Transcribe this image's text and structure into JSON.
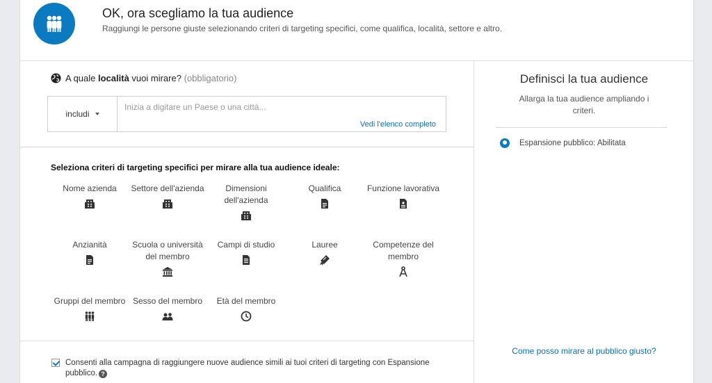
{
  "header": {
    "title": "OK, ora scegliamo la tua audience",
    "subtitle": "Raggiungi le persone giuste selezionando criteri di targeting specifici, come qualifica, località, settore e altro.",
    "icon": "group-icon",
    "accent": "#0b7bc1"
  },
  "location": {
    "prefix": "A quale ",
    "bold": "località",
    "suffix": " vuoi mirare?",
    "required": "(obbligatorio)",
    "include_label": "includi",
    "placeholder": "Inizia a digitare un Paese o una città...",
    "full_list_link": "Vedi l'elenco completo"
  },
  "criteria": {
    "title": "Seleziona criteri di targeting specifici per mirare alla tua audience ideale:",
    "items": [
      {
        "label": "Nome azienda",
        "icon": "building-icon"
      },
      {
        "label": "Settore dell'azienda",
        "icon": "building-icon"
      },
      {
        "label": "Dimensioni dell'azienda",
        "icon": "building-icon"
      },
      {
        "label": "Qualifica",
        "icon": "document-icon"
      },
      {
        "label": "Funzione lavorativa",
        "icon": "document-icon"
      },
      {
        "label": "Anzianità",
        "icon": "document-icon"
      },
      {
        "label": "Scuola o università del membro",
        "icon": "institution-icon"
      },
      {
        "label": "Campi di studio",
        "icon": "document-icon"
      },
      {
        "label": "Lauree",
        "icon": "diploma-icon"
      },
      {
        "label": "Competenze del membro",
        "icon": "compass-icon"
      },
      {
        "label": "Gruppi del membro",
        "icon": "group-icon"
      },
      {
        "label": "Sesso del membro",
        "icon": "people-icon"
      },
      {
        "label": "Età del membro",
        "icon": "clock-icon"
      }
    ]
  },
  "consent": {
    "checked": true,
    "text": "Consenti alla campagna di raggiungere nuove audience simili ai tuoi criteri di targeting con Espansione pubblico."
  },
  "audience": {
    "title": "Definisci la tua audience",
    "subtitle": "Allarga la tua audience ampliando i criteri.",
    "expansion": "Espansione pubblico: Abilitata",
    "help_link": "Come posso mirare al pubblico giusto?"
  }
}
